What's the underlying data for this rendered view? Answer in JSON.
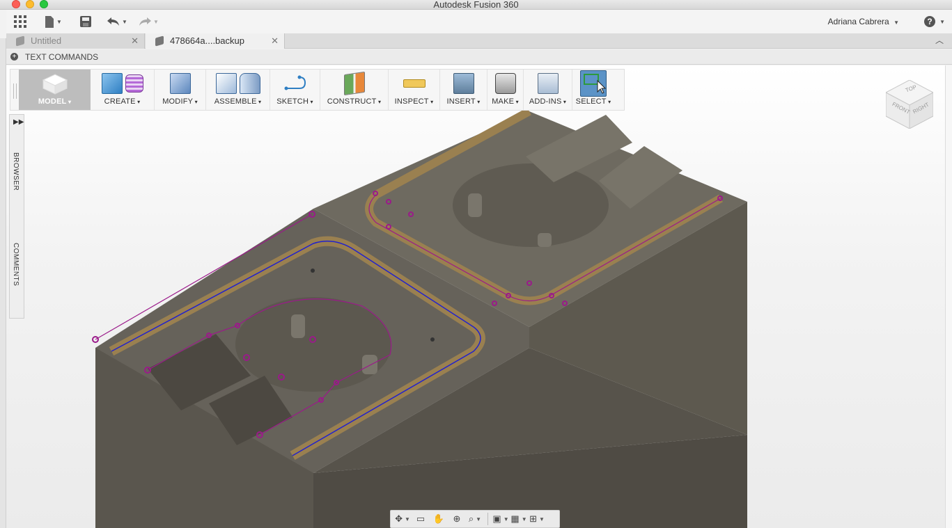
{
  "window": {
    "title": "Autodesk Fusion 360"
  },
  "quickbar": {
    "user_name": "Adriana Cabrera",
    "help_label": "?"
  },
  "tabs": [
    {
      "label": "Untitled",
      "active": false
    },
    {
      "label": "478664a....backup",
      "active": true
    }
  ],
  "text_commands": {
    "label": "TEXT COMMANDS"
  },
  "toolbar": {
    "model": "MODEL",
    "create": "CREATE",
    "modify": "MODIFY",
    "assemble": "ASSEMBLE",
    "sketch": "SKETCH",
    "construct": "CONSTRUCT",
    "inspect": "INSPECT",
    "insert": "INSERT",
    "make": "MAKE",
    "addins": "ADD-INS",
    "select": "SELECT"
  },
  "viewcube": {
    "top": "TOP",
    "front": "FRONT",
    "right": "RIGHT"
  },
  "side_panel": {
    "browser": "BROWSER",
    "comments": "COMMENTS"
  },
  "colors": {
    "model_body": "#6b665c",
    "toolpath_blue": "#2222cc",
    "toolpath_magenta": "#9b1a8a",
    "toolpath_band": "#9a8050",
    "select_accent": "#4d86ba"
  },
  "icons": {
    "app_grid": "grid-icon",
    "file": "file-icon",
    "save": "save-icon",
    "undo": "undo-icon",
    "redo": "redo-icon",
    "help": "help-icon"
  }
}
